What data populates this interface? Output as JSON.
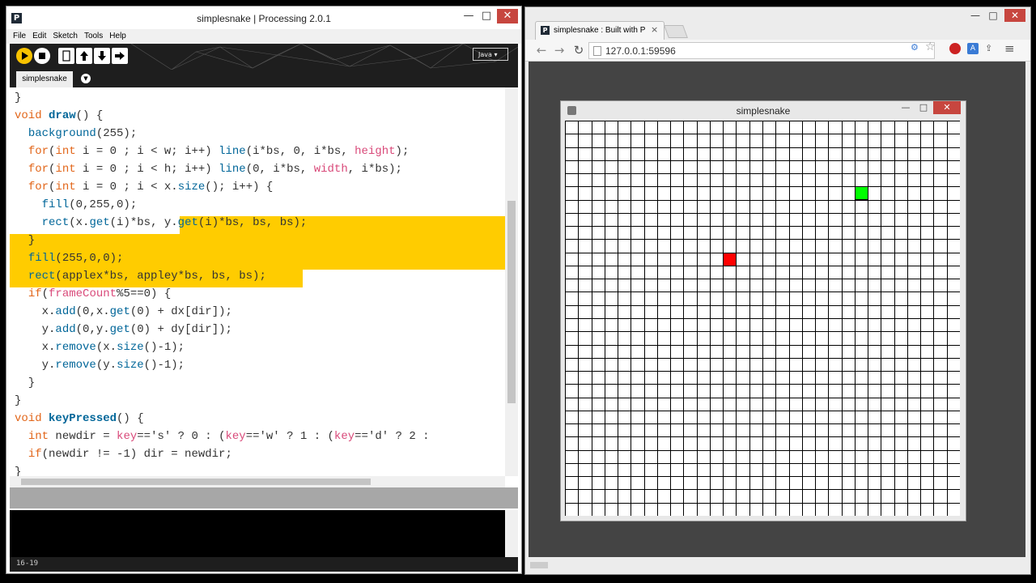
{
  "ide": {
    "title": "simplesnake | Processing 2.0.1",
    "logo": "P",
    "window_controls": {
      "minimize": "—",
      "maximize": "□",
      "close": "✕"
    },
    "menu": [
      "File",
      "Edit",
      "Sketch",
      "Tools",
      "Help"
    ],
    "mode": "Java ▾",
    "tab": "simplesnake",
    "line_number": "16-19",
    "code": [
      [
        [
          "p",
          "}"
        ]
      ],
      [
        [
          "kw",
          "void "
        ],
        [
          "fnb",
          "draw"
        ],
        [
          "p",
          "() {"
        ]
      ],
      [
        [
          "p",
          "  "
        ],
        [
          "fn",
          "background"
        ],
        [
          "p",
          "(255);"
        ]
      ],
      [
        [
          "p",
          "  "
        ],
        [
          "kw",
          "for"
        ],
        [
          "p",
          "("
        ],
        [
          "ty",
          "int"
        ],
        [
          "p",
          " i = 0 ; i < w; i++) "
        ],
        [
          "fn",
          "line"
        ],
        [
          "p",
          "(i*bs, 0, i*bs, "
        ],
        [
          "vr",
          "height"
        ],
        [
          "p",
          ");"
        ]
      ],
      [
        [
          "p",
          "  "
        ],
        [
          "kw",
          "for"
        ],
        [
          "p",
          "("
        ],
        [
          "ty",
          "int"
        ],
        [
          "p",
          " i = 0 ; i < h; i++) "
        ],
        [
          "fn",
          "line"
        ],
        [
          "p",
          "(0, i*bs, "
        ],
        [
          "vr",
          "width"
        ],
        [
          "p",
          ", i*bs);"
        ]
      ],
      [
        [
          "p",
          "  "
        ],
        [
          "kw",
          "for"
        ],
        [
          "p",
          "("
        ],
        [
          "ty",
          "int"
        ],
        [
          "p",
          " i = 0 ; i < x."
        ],
        [
          "fn",
          "size"
        ],
        [
          "p",
          "(); i++) {"
        ]
      ],
      [
        [
          "p",
          "    "
        ],
        [
          "fn",
          "fill"
        ],
        [
          "p",
          "(0,255,0);"
        ]
      ],
      [
        [
          "p",
          "    "
        ],
        [
          "fn",
          "rect"
        ],
        [
          "p",
          "(x."
        ],
        [
          "fn",
          "get"
        ],
        [
          "p",
          "(i)*bs, y."
        ],
        [
          "fn",
          "get"
        ],
        [
          "p",
          "(i)*bs, bs, bs);"
        ]
      ],
      [
        [
          "p",
          "  }"
        ]
      ],
      [
        [
          "p",
          "  "
        ],
        [
          "fn",
          "fill"
        ],
        [
          "p",
          "(255,0,0);"
        ]
      ],
      [
        [
          "p",
          "  "
        ],
        [
          "fn",
          "rect"
        ],
        [
          "p",
          "(applex*bs, appley*bs, bs, bs);"
        ]
      ],
      [
        [
          "p",
          "  "
        ],
        [
          "kw",
          "if"
        ],
        [
          "p",
          "("
        ],
        [
          "vr",
          "frameCount"
        ],
        [
          "p",
          "%5==0) {"
        ]
      ],
      [
        [
          "p",
          "    x."
        ],
        [
          "fn",
          "add"
        ],
        [
          "p",
          "(0,x."
        ],
        [
          "fn",
          "get"
        ],
        [
          "p",
          "(0) + dx[dir]);"
        ]
      ],
      [
        [
          "p",
          "    y."
        ],
        [
          "fn",
          "add"
        ],
        [
          "p",
          "(0,y."
        ],
        [
          "fn",
          "get"
        ],
        [
          "p",
          "(0) + dy[dir]);"
        ]
      ],
      [
        [
          "p",
          "    x."
        ],
        [
          "fn",
          "remove"
        ],
        [
          "p",
          "(x."
        ],
        [
          "fn",
          "size"
        ],
        [
          "p",
          "()-1);"
        ]
      ],
      [
        [
          "p",
          "    y."
        ],
        [
          "fn",
          "remove"
        ],
        [
          "p",
          "(y."
        ],
        [
          "fn",
          "size"
        ],
        [
          "p",
          "()-1);"
        ]
      ],
      [
        [
          "p",
          "  }"
        ]
      ],
      [
        [
          "p",
          "}"
        ]
      ],
      [
        [
          "kw",
          "void "
        ],
        [
          "fnb",
          "keyPressed"
        ],
        [
          "p",
          "() {"
        ]
      ],
      [
        [
          "p",
          "  "
        ],
        [
          "ty",
          "int"
        ],
        [
          "p",
          " newdir = "
        ],
        [
          "vr",
          "key"
        ],
        [
          "p",
          "=='s' ? 0 : ("
        ],
        [
          "vr",
          "key"
        ],
        [
          "p",
          "=='w' ? 1 : ("
        ],
        [
          "vr",
          "key"
        ],
        [
          "p",
          "=='d' ? 2 :"
        ]
      ],
      [
        [
          "p",
          "  "
        ],
        [
          "kw",
          "if"
        ],
        [
          "p",
          "(newdir != -1) dir = newdir;"
        ]
      ],
      [
        [
          "p",
          "}"
        ]
      ]
    ]
  },
  "browser": {
    "tab_title": "simplesnake : Built with Pr",
    "tab_icon": "P",
    "tab_close": "×",
    "url": "127.0.0.1:59596",
    "window_controls": {
      "minimize": "—",
      "maximize": "□",
      "close": "✕"
    }
  },
  "sketch": {
    "title": "simplesnake",
    "window_controls": {
      "minimize": "—",
      "maximize": "□",
      "close": "✕"
    },
    "grid": {
      "cols": 30,
      "rows": 30
    },
    "snake_cells": [
      [
        22,
        5
      ]
    ],
    "apple_cell": [
      12,
      10
    ],
    "snake_color": "#00ff00",
    "apple_color": "#ff0000"
  },
  "colors": {
    "keyword": "#e2661a",
    "function": "#006699",
    "variable": "#d94a7a",
    "highlight": "#ffcc00"
  }
}
